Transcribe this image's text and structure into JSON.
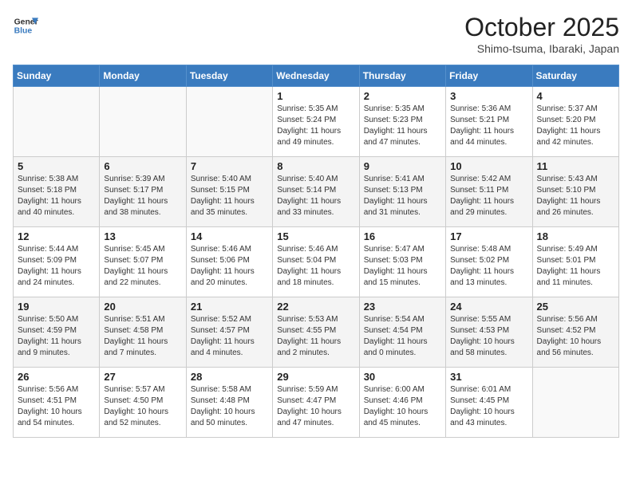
{
  "header": {
    "logo_line1": "General",
    "logo_line2": "Blue",
    "month": "October 2025",
    "location": "Shimo-tsuma, Ibaraki, Japan"
  },
  "weekdays": [
    "Sunday",
    "Monday",
    "Tuesday",
    "Wednesday",
    "Thursday",
    "Friday",
    "Saturday"
  ],
  "weeks": [
    [
      {
        "day": "",
        "text": ""
      },
      {
        "day": "",
        "text": ""
      },
      {
        "day": "",
        "text": ""
      },
      {
        "day": "1",
        "text": "Sunrise: 5:35 AM\nSunset: 5:24 PM\nDaylight: 11 hours and 49 minutes."
      },
      {
        "day": "2",
        "text": "Sunrise: 5:35 AM\nSunset: 5:23 PM\nDaylight: 11 hours and 47 minutes."
      },
      {
        "day": "3",
        "text": "Sunrise: 5:36 AM\nSunset: 5:21 PM\nDaylight: 11 hours and 44 minutes."
      },
      {
        "day": "4",
        "text": "Sunrise: 5:37 AM\nSunset: 5:20 PM\nDaylight: 11 hours and 42 minutes."
      }
    ],
    [
      {
        "day": "5",
        "text": "Sunrise: 5:38 AM\nSunset: 5:18 PM\nDaylight: 11 hours and 40 minutes."
      },
      {
        "day": "6",
        "text": "Sunrise: 5:39 AM\nSunset: 5:17 PM\nDaylight: 11 hours and 38 minutes."
      },
      {
        "day": "7",
        "text": "Sunrise: 5:40 AM\nSunset: 5:15 PM\nDaylight: 11 hours and 35 minutes."
      },
      {
        "day": "8",
        "text": "Sunrise: 5:40 AM\nSunset: 5:14 PM\nDaylight: 11 hours and 33 minutes."
      },
      {
        "day": "9",
        "text": "Sunrise: 5:41 AM\nSunset: 5:13 PM\nDaylight: 11 hours and 31 minutes."
      },
      {
        "day": "10",
        "text": "Sunrise: 5:42 AM\nSunset: 5:11 PM\nDaylight: 11 hours and 29 minutes."
      },
      {
        "day": "11",
        "text": "Sunrise: 5:43 AM\nSunset: 5:10 PM\nDaylight: 11 hours and 26 minutes."
      }
    ],
    [
      {
        "day": "12",
        "text": "Sunrise: 5:44 AM\nSunset: 5:09 PM\nDaylight: 11 hours and 24 minutes."
      },
      {
        "day": "13",
        "text": "Sunrise: 5:45 AM\nSunset: 5:07 PM\nDaylight: 11 hours and 22 minutes."
      },
      {
        "day": "14",
        "text": "Sunrise: 5:46 AM\nSunset: 5:06 PM\nDaylight: 11 hours and 20 minutes."
      },
      {
        "day": "15",
        "text": "Sunrise: 5:46 AM\nSunset: 5:04 PM\nDaylight: 11 hours and 18 minutes."
      },
      {
        "day": "16",
        "text": "Sunrise: 5:47 AM\nSunset: 5:03 PM\nDaylight: 11 hours and 15 minutes."
      },
      {
        "day": "17",
        "text": "Sunrise: 5:48 AM\nSunset: 5:02 PM\nDaylight: 11 hours and 13 minutes."
      },
      {
        "day": "18",
        "text": "Sunrise: 5:49 AM\nSunset: 5:01 PM\nDaylight: 11 hours and 11 minutes."
      }
    ],
    [
      {
        "day": "19",
        "text": "Sunrise: 5:50 AM\nSunset: 4:59 PM\nDaylight: 11 hours and 9 minutes."
      },
      {
        "day": "20",
        "text": "Sunrise: 5:51 AM\nSunset: 4:58 PM\nDaylight: 11 hours and 7 minutes."
      },
      {
        "day": "21",
        "text": "Sunrise: 5:52 AM\nSunset: 4:57 PM\nDaylight: 11 hours and 4 minutes."
      },
      {
        "day": "22",
        "text": "Sunrise: 5:53 AM\nSunset: 4:55 PM\nDaylight: 11 hours and 2 minutes."
      },
      {
        "day": "23",
        "text": "Sunrise: 5:54 AM\nSunset: 4:54 PM\nDaylight: 11 hours and 0 minutes."
      },
      {
        "day": "24",
        "text": "Sunrise: 5:55 AM\nSunset: 4:53 PM\nDaylight: 10 hours and 58 minutes."
      },
      {
        "day": "25",
        "text": "Sunrise: 5:56 AM\nSunset: 4:52 PM\nDaylight: 10 hours and 56 minutes."
      }
    ],
    [
      {
        "day": "26",
        "text": "Sunrise: 5:56 AM\nSunset: 4:51 PM\nDaylight: 10 hours and 54 minutes."
      },
      {
        "day": "27",
        "text": "Sunrise: 5:57 AM\nSunset: 4:50 PM\nDaylight: 10 hours and 52 minutes."
      },
      {
        "day": "28",
        "text": "Sunrise: 5:58 AM\nSunset: 4:48 PM\nDaylight: 10 hours and 50 minutes."
      },
      {
        "day": "29",
        "text": "Sunrise: 5:59 AM\nSunset: 4:47 PM\nDaylight: 10 hours and 47 minutes."
      },
      {
        "day": "30",
        "text": "Sunrise: 6:00 AM\nSunset: 4:46 PM\nDaylight: 10 hours and 45 minutes."
      },
      {
        "day": "31",
        "text": "Sunrise: 6:01 AM\nSunset: 4:45 PM\nDaylight: 10 hours and 43 minutes."
      },
      {
        "day": "",
        "text": ""
      }
    ]
  ]
}
